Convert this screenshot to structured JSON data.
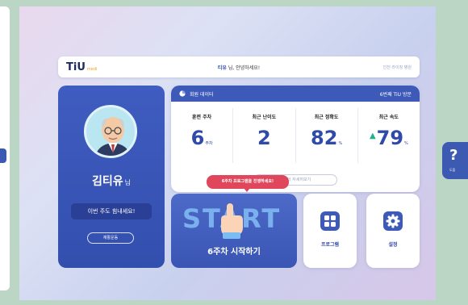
{
  "topbar": {
    "logo_main": "TiU",
    "logo_sub": "medi",
    "greeting_name": "티유",
    "greeting_text": "님, 안녕하세요!",
    "hospital": "인천 라이징 병원"
  },
  "profile": {
    "name": "김티유",
    "name_suffix": "님",
    "cheer": "이번 주도 힘내세요!",
    "rehab_button": "재활운동"
  },
  "stats": {
    "header": "회원 데이터",
    "visit": "6번째 TiU 방문",
    "items": [
      {
        "label": "훈련 주차",
        "value": "6",
        "unit": "주차"
      },
      {
        "label": "최근 난이도",
        "value": "2",
        "unit": ""
      },
      {
        "label": "최근 정확도",
        "value": "82",
        "unit": "%"
      },
      {
        "label": "최근 속도",
        "value": "79",
        "unit": "%",
        "trend": "up"
      }
    ],
    "detail_button": "데이터 자세히보기"
  },
  "start": {
    "word": "START",
    "caption": "6주차 시작하기",
    "tooltip": "6주차 프로그램을 진행하세요!"
  },
  "tiles": {
    "program": "프로그램",
    "settings": "설정"
  },
  "help": {
    "symbol": "?",
    "label": "도움"
  },
  "colors": {
    "primary": "#3d5ab8",
    "accent_red": "#e0475d",
    "trend_green": "#21b08c",
    "background_green": "#bcd6c6"
  }
}
